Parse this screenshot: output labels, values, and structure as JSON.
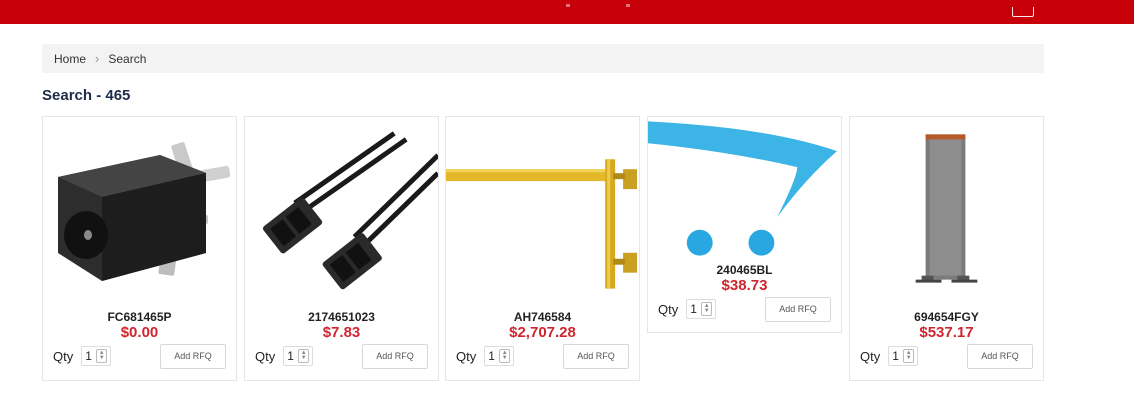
{
  "breadcrumb": {
    "items": [
      "Home",
      "Search"
    ]
  },
  "page": {
    "title": "Search - 465"
  },
  "colors": {
    "brand": "#c8000a",
    "price": "#d0252f",
    "title": "#1e2d4a"
  },
  "icons": [
    "chevron-right-icon",
    "stepper-icon",
    "cart-icon"
  ],
  "products": [
    {
      "name": "FC681465P",
      "price": "$0.00",
      "qty_label": "Qty",
      "qty": "1",
      "button": "Add RFQ"
    },
    {
      "name": "2174651023",
      "price": "$7.83",
      "qty_label": "Qty",
      "qty": "1",
      "button": "Add RFQ"
    },
    {
      "name": "AH746584",
      "price": "$2,707.28",
      "qty_label": "Qty",
      "qty": "1",
      "button": "Add RFQ"
    },
    {
      "name": "240465BL",
      "price": "$38.73",
      "qty_label": "Qty",
      "qty": "1",
      "button": "Add RFQ"
    },
    {
      "name": "694654FGY",
      "price": "$537.17",
      "qty_label": "Qty",
      "qty": "1",
      "button": "Add RFQ"
    }
  ]
}
